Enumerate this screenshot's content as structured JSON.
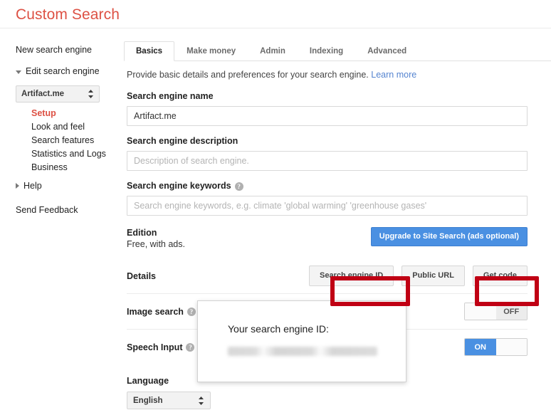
{
  "header": {
    "title": "Custom Search"
  },
  "sidebar": {
    "new_engine": "New search engine",
    "edit_engine": "Edit search engine",
    "engine_select": {
      "value": "Artifact.me",
      "icon": "updown-spinner-icon"
    },
    "sub_items": [
      {
        "label": "Setup",
        "active": true
      },
      {
        "label": "Look and feel",
        "active": false
      },
      {
        "label": "Search features",
        "active": false
      },
      {
        "label": "Statistics and Logs",
        "active": false
      },
      {
        "label": "Business",
        "active": false
      }
    ],
    "help": "Help",
    "send_feedback": "Send Feedback"
  },
  "tabs": [
    {
      "label": "Basics",
      "active": true
    },
    {
      "label": "Make money",
      "active": false
    },
    {
      "label": "Admin",
      "active": false
    },
    {
      "label": "Indexing",
      "active": false
    },
    {
      "label": "Advanced",
      "active": false
    }
  ],
  "intro": {
    "text": "Provide basic details and preferences for your search engine.",
    "link": "Learn more"
  },
  "form": {
    "name_label": "Search engine name",
    "name_value": "Artifact.me",
    "description_label": "Search engine description",
    "description_placeholder": "Description of search engine.",
    "keywords_label": "Search engine keywords",
    "keywords_placeholder": "Search engine keywords, e.g. climate 'global warming' 'greenhouse gases'",
    "help_glyph": "?"
  },
  "edition": {
    "title": "Edition",
    "subtitle": "Free, with ads.",
    "upgrade_button": "Upgrade to Site Search (ads optional)"
  },
  "details": {
    "label": "Details",
    "buttons": [
      {
        "label": "Search engine ID",
        "highlighted": true
      },
      {
        "label": "Public URL",
        "highlighted": false
      },
      {
        "label": "Get code",
        "highlighted": true
      }
    ]
  },
  "toggles": [
    {
      "label": "Image search",
      "state": "OFF",
      "on": false
    },
    {
      "label": "Speech Input",
      "state": "ON",
      "on": true
    }
  ],
  "language": {
    "label": "Language",
    "value": "English",
    "icon": "updown-spinner-icon"
  },
  "popup": {
    "title": "Your search engine ID:",
    "id_value": ""
  },
  "colors": {
    "brand_red": "#dd5144",
    "annotation_red": "#c00014",
    "accent_blue": "#4a90e2",
    "link_blue": "#5584d0"
  }
}
